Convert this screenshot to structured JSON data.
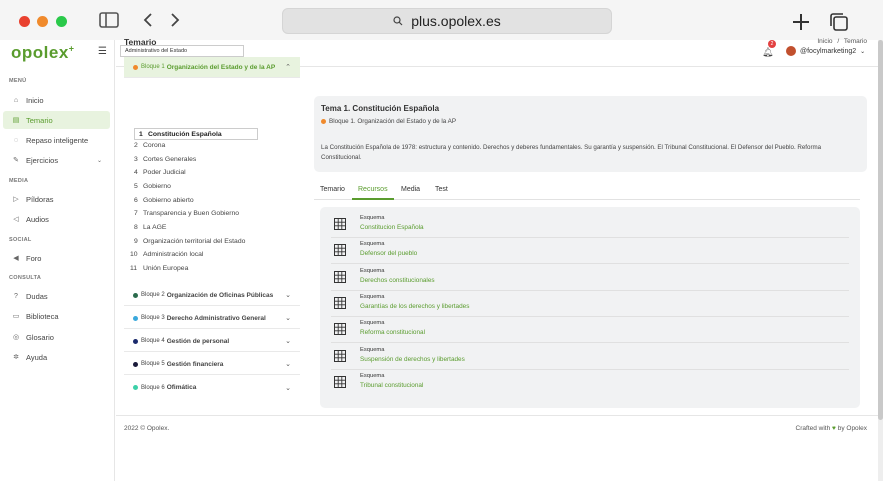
{
  "browser": {
    "url": "plus.opolex.es",
    "icons": [
      "sidebar-toggle-icon",
      "back-icon",
      "forward-icon",
      "search-icon",
      "new-tab-icon",
      "tabs-icon"
    ]
  },
  "logo": {
    "text": "opolex",
    "plus": "+"
  },
  "sidebar": {
    "sections": {
      "media": "MEDIA",
      "menu": "MENÚ",
      "social": "SOCIAL",
      "consulta": "CONSULTA"
    },
    "items": [
      {
        "label": "Inicio",
        "icon": "home-icon"
      },
      {
        "label": "Temario",
        "icon": "document-icon"
      },
      {
        "label": "Repaso inteligente",
        "icon": "bulb-icon"
      },
      {
        "label": "Ejercicios",
        "icon": "edit-icon"
      },
      {
        "label": "Píldoras",
        "icon": "play-icon"
      },
      {
        "label": "Audios",
        "icon": "speaker-icon"
      },
      {
        "label": "Foro",
        "icon": "megaphone-icon"
      },
      {
        "label": "Dudas",
        "icon": "question-icon"
      },
      {
        "label": "Biblioteca",
        "icon": "book-icon"
      },
      {
        "label": "Glosario",
        "icon": "glossary-icon"
      },
      {
        "label": "Ayuda",
        "icon": "help-icon"
      }
    ]
  },
  "topbar": {
    "select_value": "Administrativo del Estado",
    "notifications": "2",
    "username": "@focylmarketing2"
  },
  "page": {
    "title": "Temario",
    "breadcrumb_home": "Inicio",
    "breadcrumb_sep": "/",
    "breadcrumb_current": "Temario"
  },
  "blocks": [
    {
      "prefix": "Bloque 1",
      "name": "Organización del Estado y de la AP",
      "color": "#f08a2c"
    },
    {
      "prefix": "Bloque 2",
      "name": "Organización de Oficinas Públicas",
      "color": "#2b6b4c"
    },
    {
      "prefix": "Bloque 3",
      "name": "Derecho Administrativo General",
      "color": "#3aa8dc"
    },
    {
      "prefix": "Bloque 4",
      "name": "Gestión de personal",
      "color": "#1a2a6c"
    },
    {
      "prefix": "Bloque 5",
      "name": "Gestión financiera",
      "color": "#1b1b3a"
    },
    {
      "prefix": "Bloque 6",
      "name": "Ofimática",
      "color": "#3cd0a8"
    }
  ],
  "topics": [
    {
      "n": "1",
      "label": "Constitución Española"
    },
    {
      "n": "2",
      "label": "Corona"
    },
    {
      "n": "3",
      "label": "Cortes Generales"
    },
    {
      "n": "4",
      "label": "Poder Judicial"
    },
    {
      "n": "5",
      "label": "Gobierno"
    },
    {
      "n": "6",
      "label": "Gobierno abierto"
    },
    {
      "n": "7",
      "label": "Transparencia y Buen Gobierno"
    },
    {
      "n": "8",
      "label": "La AGE"
    },
    {
      "n": "9",
      "label": "Organización territorial del Estado"
    },
    {
      "n": "10",
      "label": "Administración local"
    },
    {
      "n": "11",
      "label": "Unión Europea"
    }
  ],
  "tema": {
    "title": "Tema 1. Constitución Española",
    "block": "Bloque 1. Organización del Estado y de la AP",
    "description": "La Constitución Española de 1978: estructura y contenido. Derechos y deberes fundamentales. Su garantía y suspensión. El Tribunal Constitucional. El Defensor del Pueblo. Reforma Constitucional."
  },
  "tabs": [
    "Temario",
    "Recursos",
    "Media",
    "Test"
  ],
  "resources": [
    {
      "type": "Esquema",
      "title": "Constitucion Española"
    },
    {
      "type": "Esquema",
      "title": "Defensor del pueblo"
    },
    {
      "type": "Esquema",
      "title": "Derechos constitucionales"
    },
    {
      "type": "Esquema",
      "title": "Garantías de los derechos y libertades"
    },
    {
      "type": "Esquema",
      "title": "Reforma constitucional"
    },
    {
      "type": "Esquema",
      "title": "Suspensión de derechos y libertades"
    },
    {
      "type": "Esquema",
      "title": "Tribunal constitucional"
    }
  ],
  "footer": {
    "left": "2022 © Opolex.",
    "crafted": "Crafted with",
    "heart": "♥",
    "by": "by Opolex"
  },
  "colors": {
    "accent": "#5a9c2e",
    "accent_bg": "#e8f3df"
  }
}
